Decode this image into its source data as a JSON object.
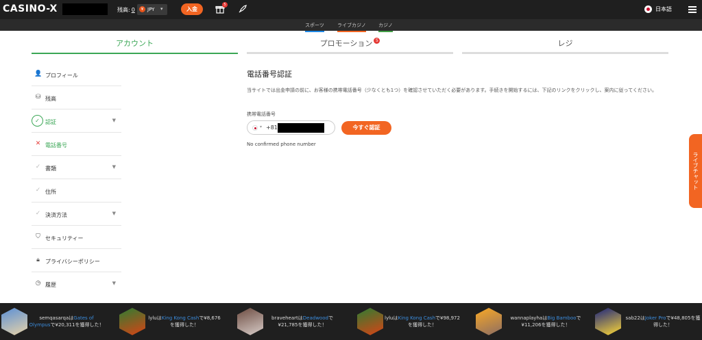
{
  "header": {
    "logo": "CASINO-X",
    "balance_label": "残高:",
    "balance_value": "0",
    "currency": "JPY",
    "currency_symbol": "¥",
    "deposit_label": "入金",
    "gift_badge": "5",
    "language": "日本語"
  },
  "subnav": {
    "sports": "スポーツ",
    "live_casino": "ライブカジノ",
    "casino": "カジノ"
  },
  "tabs": {
    "account": "アカウント",
    "promotion": "プロモーション",
    "promotion_badge": "5",
    "cashier": "レジ"
  },
  "sidebar": {
    "profile": "プロフィール",
    "balance": "残高",
    "verification": "認証",
    "phone_number": "電話番号",
    "documents": "書類",
    "address": "住所",
    "payment_methods": "決済方法",
    "security": "セキュリティー",
    "privacy_policy": "プライバシーポリシー",
    "history": "履歴"
  },
  "main": {
    "title": "電話番号認証",
    "description": "当サイトでは出金申請の前に、お客様の携帯電話番号（少なくとも1つ）を確認させていただく必要があります。手続きを開始するには、下記のリンクをクリックし、案内に従ってください。",
    "phone_label": "携帯電話番号",
    "country_code": "+81",
    "verify_button": "今すぐ認証",
    "status": "No confirmed phone number"
  },
  "live_chat": "ライブチャット",
  "winners": [
    {
      "user": "semqasarqa",
      "game": "Gates of Olympus",
      "amount": "¥20,311",
      "pre": "で",
      "post": "を獲得した！"
    },
    {
      "user": "lylu",
      "game": "King Kong Cash",
      "amount": "¥8,676",
      "pre": "で",
      "post": "を獲得した！"
    },
    {
      "user": "braveheart",
      "game": "Deadwood",
      "amount": "¥21,785",
      "pre": "で",
      "post": "を獲得した！"
    },
    {
      "user": "lylu",
      "game": "King Kong Cash",
      "amount": "¥98,972",
      "pre": "で",
      "post": "を獲得した！"
    },
    {
      "user": "wannaplayha",
      "game": "Big Bamboo",
      "amount": "¥11,206",
      "pre": "で",
      "post": "を獲得した！"
    },
    {
      "user": "sab22",
      "game": "Joker Pro",
      "amount": "¥48,805",
      "pre": "で",
      "post": "を獲得した！"
    }
  ],
  "colors": {
    "accent_green": "#3aa655",
    "accent_orange": "#f26522",
    "header_bg": "#1f1f1f"
  }
}
